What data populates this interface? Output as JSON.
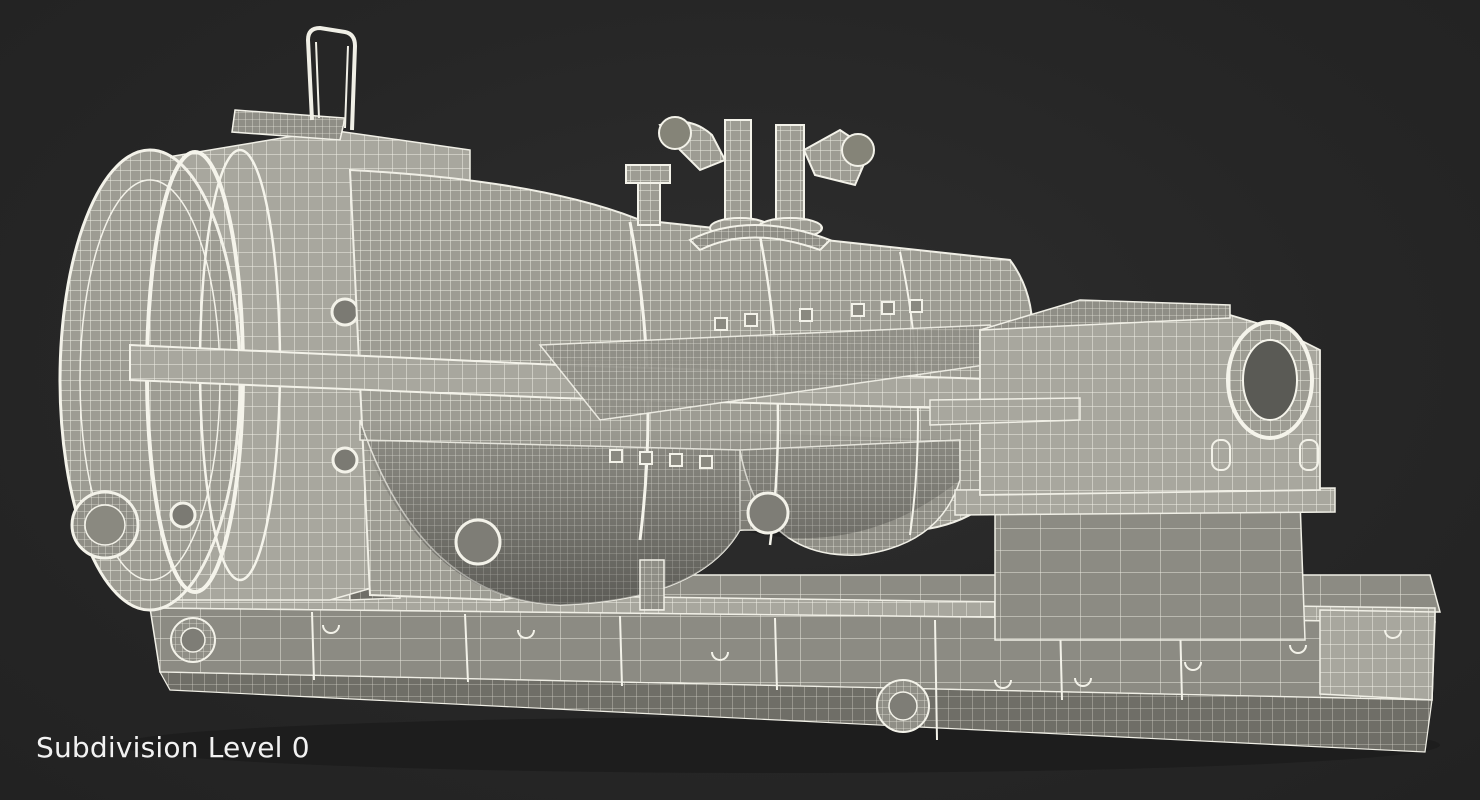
{
  "caption": "Subdivision Level 0"
}
